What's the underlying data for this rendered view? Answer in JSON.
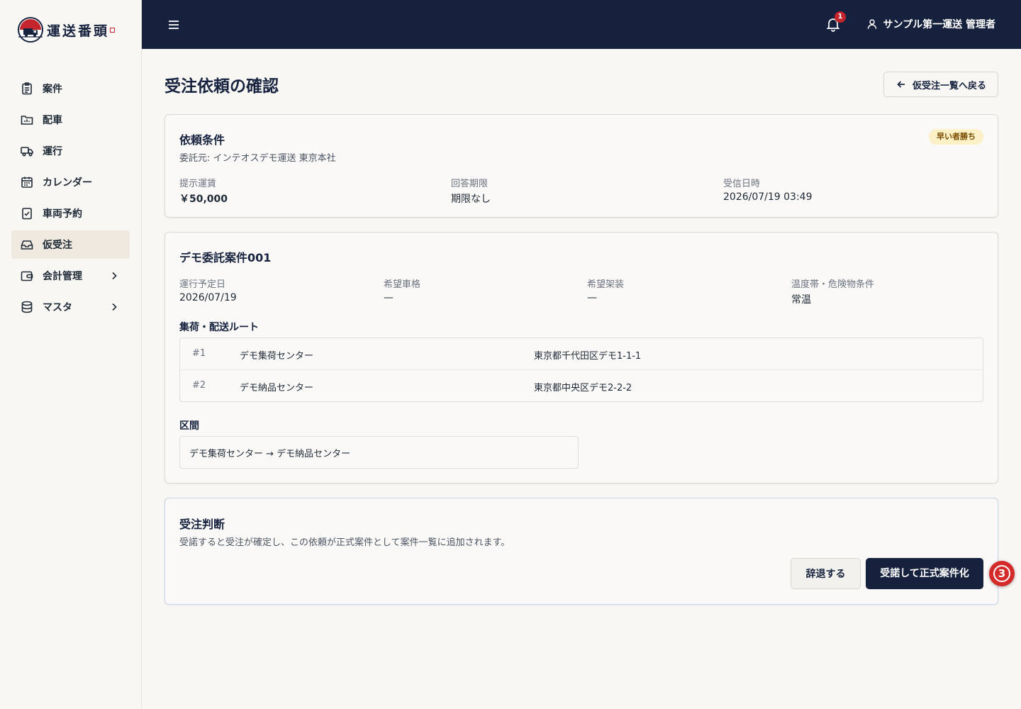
{
  "brand": {
    "name": "運送番頭"
  },
  "sidebar": {
    "items": [
      {
        "label": "案件",
        "icon": "clipboard-icon"
      },
      {
        "label": "配車",
        "icon": "folder-chart-icon"
      },
      {
        "label": "運行",
        "icon": "truck-icon"
      },
      {
        "label": "カレンダー",
        "icon": "calendar-icon"
      },
      {
        "label": "車両予約",
        "icon": "clipboard-check-icon"
      },
      {
        "label": "仮受注",
        "icon": "inbox-icon",
        "active": true
      },
      {
        "label": "会計管理",
        "icon": "wallet-icon",
        "expandable": true
      },
      {
        "label": "マスタ",
        "icon": "database-icon",
        "expandable": true
      }
    ]
  },
  "header": {
    "notification_count": "1",
    "user_label": "サンプル第一運送 管理者"
  },
  "page": {
    "title": "受注依頼の確認",
    "back_label": "仮受注一覧へ戻る"
  },
  "request": {
    "title": "依頼条件",
    "client": "委託元: インテオスデモ運送 東京本社",
    "badge": "早い者勝ち",
    "fields": [
      {
        "label": "提示運賃",
        "value": "￥50,000"
      },
      {
        "label": "回答期限",
        "value": "期限なし"
      },
      {
        "label": "受信日時",
        "value": "2026/07/19 03:49"
      }
    ]
  },
  "case": {
    "title": "デモ委託案件001",
    "fields": [
      {
        "label": "運行予定日",
        "value": "2026/07/19"
      },
      {
        "label": "希望車格",
        "value": "—"
      },
      {
        "label": "希望架装",
        "value": "—"
      },
      {
        "label": "温度帯・危険物条件",
        "value": "常温"
      }
    ],
    "route_label": "集荷・配送ルート",
    "route": [
      {
        "no": "#1",
        "name": "デモ集荷センター",
        "address": "東京都千代田区デモ1-1-1"
      },
      {
        "no": "#2",
        "name": "デモ納品センター",
        "address": "東京都中央区デモ2-2-2"
      }
    ],
    "section_label": "区間",
    "section_value": "デモ集荷センター → デモ納品センター"
  },
  "decision": {
    "title": "受注判断",
    "description": "受諾すると受注が確定し、この依頼が正式案件として案件一覧に追加されます。",
    "decline_label": "辞退する",
    "accept_label": "受諾して正式案件化"
  },
  "annotation": {
    "marker": "3"
  },
  "colors": {
    "navy": "#15213d",
    "accent_red": "#c4242b",
    "badge_bg": "#fbf0c6"
  }
}
